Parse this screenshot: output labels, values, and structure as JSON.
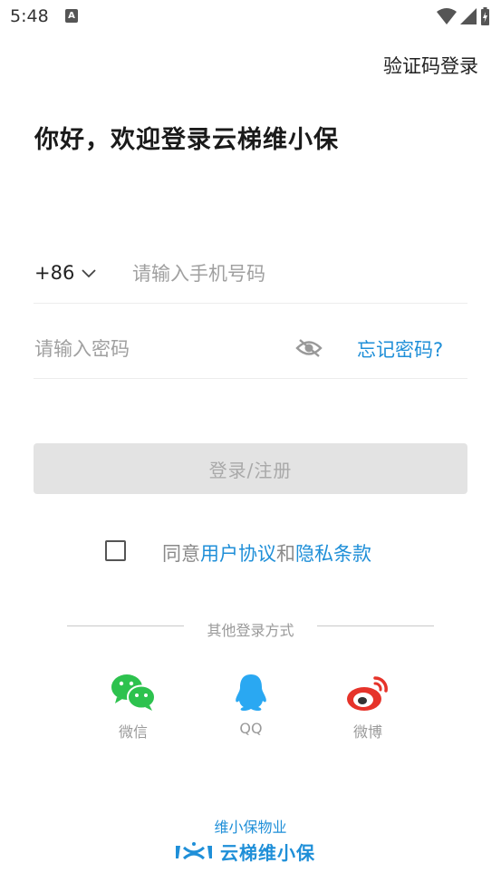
{
  "status_bar": {
    "time": "5:48",
    "notification_icon": "A"
  },
  "header": {
    "switch_login_label": "验证码登录",
    "greeting": "你好，欢迎登录云梯维小保"
  },
  "phone": {
    "country_code": "+86",
    "placeholder": "请输入手机号码"
  },
  "password": {
    "placeholder": "请输入密码",
    "forgot_label": "忘记密码?"
  },
  "login_button": {
    "label": "登录/注册"
  },
  "agreement": {
    "prefix": "同意",
    "user_agreement": "用户协议",
    "and": "和",
    "privacy": "隐私条款"
  },
  "other_login": {
    "title": "其他登录方式",
    "providers": [
      {
        "label": "微信",
        "icon": "wechat-icon"
      },
      {
        "label": "QQ",
        "icon": "qq-icon"
      },
      {
        "label": "微博",
        "icon": "weibo-icon"
      }
    ]
  },
  "footer": {
    "company": "维小保物业",
    "brand": "云梯维小保"
  },
  "colors": {
    "accent": "#1f8fd8",
    "wechat": "#2dc24e",
    "qq": "#2aa8f2",
    "weibo": "#e6332a",
    "button_disabled": "#e3e3e3"
  }
}
